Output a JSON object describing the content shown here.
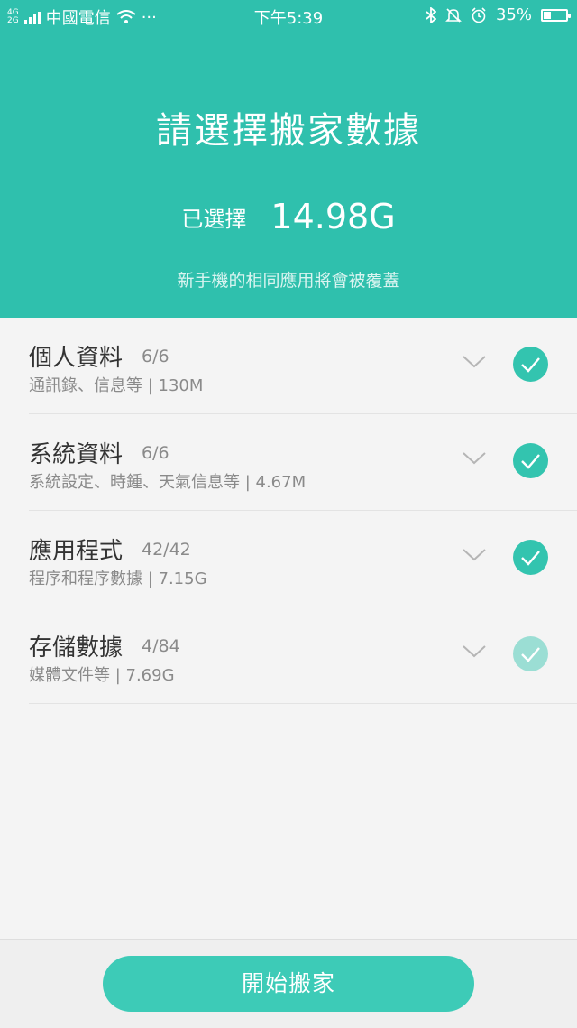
{
  "status_bar": {
    "network_top": "4G",
    "network_bottom": "2G",
    "carrier": "中國電信",
    "more": "···",
    "time": "下午5:39",
    "battery_percent": "35%",
    "battery_level": 0.35,
    "icons": [
      "signal-icon",
      "wifi-icon",
      "bluetooth-icon",
      "mute-icon",
      "alarm-icon",
      "battery-icon"
    ]
  },
  "header": {
    "title": "請選擇搬家數據",
    "selected_label": "已選擇",
    "selected_value": "14.98G",
    "note": "新手機的相同應用將會被覆蓋"
  },
  "categories": [
    {
      "name": "個人資料",
      "count": "6/6",
      "detail": "通訊錄、信息等 | 130M",
      "state": "checked"
    },
    {
      "name": "系統資料",
      "count": "6/6",
      "detail": "系統設定、時鍾、天氣信息等 | 4.67M",
      "state": "checked"
    },
    {
      "name": "應用程式",
      "count": "42/42",
      "detail": "程序和程序數據 | 7.15G",
      "state": "checked"
    },
    {
      "name": "存儲數據",
      "count": "4/84",
      "detail": "媒體文件等 | 7.69G",
      "state": "partial"
    }
  ],
  "footer": {
    "start_button": "開始搬家"
  },
  "colors": {
    "accent": "#2fc0ad",
    "check": "#33c4af",
    "check_partial": "#9bded4",
    "button": "#3dcbb7"
  }
}
